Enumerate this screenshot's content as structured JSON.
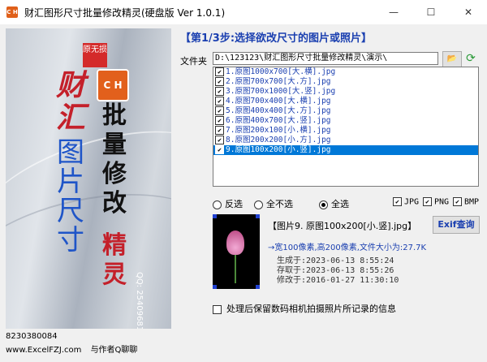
{
  "window": {
    "title": "财汇图形尺寸批量修改精灵(硬盘版 Ver 1.0.1)",
    "icon_text": "C H",
    "controls": {
      "minimize": "—",
      "maximize": "☐",
      "close": "✕"
    }
  },
  "banner": {
    "tag": "原无损",
    "logo": "C H",
    "brand": "财汇",
    "title_col1": "图片尺寸",
    "title_col2": "批量修改",
    "title_col3": "精灵",
    "qq": "QQ: 254096810"
  },
  "below_banner": "8230380084",
  "footer": {
    "link": "www.ExcelFZJ.com",
    "contact": "与作者Q聊聊"
  },
  "step": {
    "title": "【第1/3步:选择欲改尺寸的图片或照片】"
  },
  "folder": {
    "label": "文件夹",
    "path": "D:\\123123\\财汇图形尺寸批量修改精灵\\演示\\",
    "open_icon": "folder-open",
    "refresh_icon": "refresh"
  },
  "files": [
    {
      "name": "1.原图1000x700[大.横].jpg",
      "checked": true,
      "selected": false
    },
    {
      "name": "2.原图700x700[大.方].jpg",
      "checked": true,
      "selected": false
    },
    {
      "name": "3.原图700x1000[大.竖].jpg",
      "checked": true,
      "selected": false
    },
    {
      "name": "4.原图700x400[大.横].jpg",
      "checked": true,
      "selected": false
    },
    {
      "name": "5.原图400x400[大.方].jpg",
      "checked": true,
      "selected": false
    },
    {
      "name": "6.原图400x700[大.竖].jpg",
      "checked": true,
      "selected": false
    },
    {
      "name": "7.原图200x100[小.横].jpg",
      "checked": true,
      "selected": false
    },
    {
      "name": "8.原图200x200[小.方].jpg",
      "checked": true,
      "selected": false
    },
    {
      "name": "9.原图100x200[小.竖].jpg",
      "checked": true,
      "selected": true
    }
  ],
  "selection": {
    "invert": "反选",
    "none": "全不选",
    "all": "全选",
    "selected_option": "all"
  },
  "formats": [
    {
      "label": "JPG",
      "checked": true
    },
    {
      "label": "PNG",
      "checked": true
    },
    {
      "label": "BMP",
      "checked": true
    }
  ],
  "preview": {
    "file_title": "【图片9. 原图100x200[小.竖].jpg】",
    "exif_button": "Exif查询",
    "size_info": "→宽100像素,高200像素,文件大小为:27.7K",
    "created": "生成于:2023-06-13 8:55:24",
    "accessed": "存取于:2023-06-13 8:55:26",
    "modified": "修改于:2016-01-27 11:30:10"
  },
  "keep_exif": {
    "label": "处理后保留数码相机拍摄照片所记录的信息",
    "checked": false
  },
  "colors": {
    "accent": "#1a3fb0",
    "selection": "#0078d7",
    "brand_red": "#c4202a",
    "logo_orange": "#e2601c"
  }
}
